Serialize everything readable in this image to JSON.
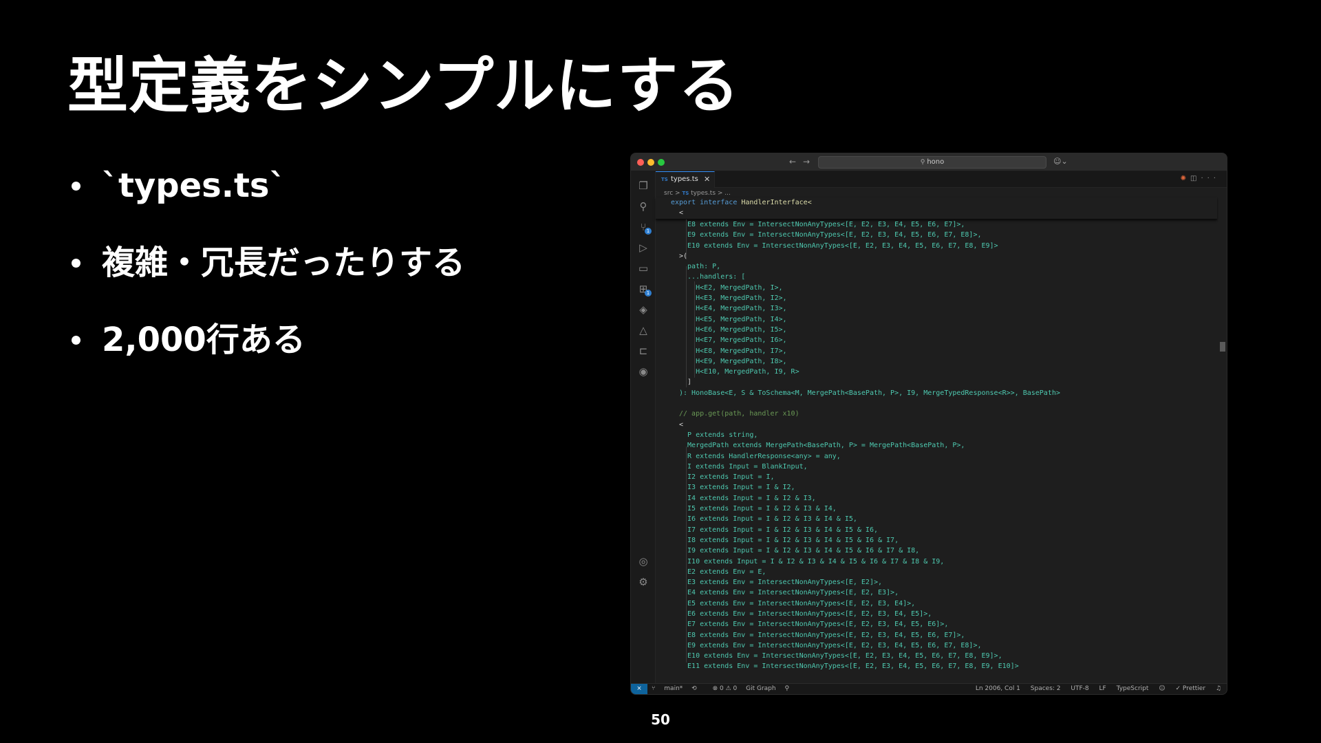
{
  "slide": {
    "title": "型定義をシンプルにする",
    "bullets": [
      "`types.ts`",
      "複雑・冗長だったりする",
      "2,000行ある"
    ],
    "page_number": "50"
  },
  "editor": {
    "search_text": "hono",
    "tab": {
      "icon": "TS",
      "name": "types.ts",
      "close": "✕"
    },
    "breadcrumb": {
      "folder": "src",
      "sep": ">",
      "icon": "TS",
      "file": "types.ts",
      "tail": "> ..."
    },
    "sticky": {
      "line1_kw1": "export",
      "line1_kw2": "interface",
      "line1_name": "HandlerInterface<",
      "line2": "<"
    },
    "code_lines": [
      "  E8 extends Env = IntersectNonAnyTypes<[E, E2, E3, E4, E5, E6, E7]>,",
      "  E9 extends Env = IntersectNonAnyTypes<[E, E2, E3, E4, E5, E6, E7, E8]>,",
      "  E10 extends Env = IntersectNonAnyTypes<[E, E2, E3, E4, E5, E6, E7, E8, E9]>",
      ">(",
      "  path: P,",
      "  ...handlers: [",
      "    H<E2, MergedPath, I>,",
      "    H<E3, MergedPath, I2>,",
      "    H<E4, MergedPath, I3>,",
      "    H<E5, MergedPath, I4>,",
      "    H<E6, MergedPath, I5>,",
      "    H<E7, MergedPath, I6>,",
      "    H<E8, MergedPath, I7>,",
      "    H<E9, MergedPath, I8>,",
      "    H<E10, MergedPath, I9, R>",
      "  ]",
      "): HonoBase<E, S & ToSchema<M, MergePath<BasePath, P>, I9, MergeTypedResponse<R>>, BasePath>",
      "",
      "// app.get(path, handler x10)",
      "<",
      "  P extends string,",
      "  MergedPath extends MergePath<BasePath, P> = MergePath<BasePath, P>,",
      "  R extends HandlerResponse<any> = any,",
      "  I extends Input = BlankInput,",
      "  I2 extends Input = I,",
      "  I3 extends Input = I & I2,",
      "  I4 extends Input = I & I2 & I3,",
      "  I5 extends Input = I & I2 & I3 & I4,",
      "  I6 extends Input = I & I2 & I3 & I4 & I5,",
      "  I7 extends Input = I & I2 & I3 & I4 & I5 & I6,",
      "  I8 extends Input = I & I2 & I3 & I4 & I5 & I6 & I7,",
      "  I9 extends Input = I & I2 & I3 & I4 & I5 & I6 & I7 & I8,",
      "  I10 extends Input = I & I2 & I3 & I4 & I5 & I6 & I7 & I8 & I9,",
      "  E2 extends Env = E,",
      "  E3 extends Env = IntersectNonAnyTypes<[E, E2]>,",
      "  E4 extends Env = IntersectNonAnyTypes<[E, E2, E3]>,",
      "  E5 extends Env = IntersectNonAnyTypes<[E, E2, E3, E4]>,",
      "  E6 extends Env = IntersectNonAnyTypes<[E, E2, E3, E4, E5]>,",
      "  E7 extends Env = IntersectNonAnyTypes<[E, E2, E3, E4, E5, E6]>,",
      "  E8 extends Env = IntersectNonAnyTypes<[E, E2, E3, E4, E5, E6, E7]>,",
      "  E9 extends Env = IntersectNonAnyTypes<[E, E2, E3, E4, E5, E6, E7, E8]>,",
      "  E10 extends Env = IntersectNonAnyTypes<[E, E2, E3, E4, E5, E6, E7, E8, E9]>,",
      "  E11 extends Env = IntersectNonAnyTypes<[E, E2, E3, E4, E5, E6, E7, E8, E9, E10]>",
      ">("
    ],
    "status": {
      "branch": "main*",
      "problems": "⊗ 0 ⚠ 0",
      "git_graph": "Git Graph",
      "position": "Ln 2006, Col 1",
      "spaces": "Spaces: 2",
      "encoding": "UTF-8",
      "eol": "LF",
      "language": "TypeScript",
      "prettier": "✓ Prettier"
    },
    "colors": {
      "type_text": "#4ec9b0",
      "keyword": "#569cd6",
      "comment": "#6a9955",
      "accent": "#0e639c"
    },
    "badges": {
      "source_control": "1",
      "extensions": "1"
    }
  }
}
